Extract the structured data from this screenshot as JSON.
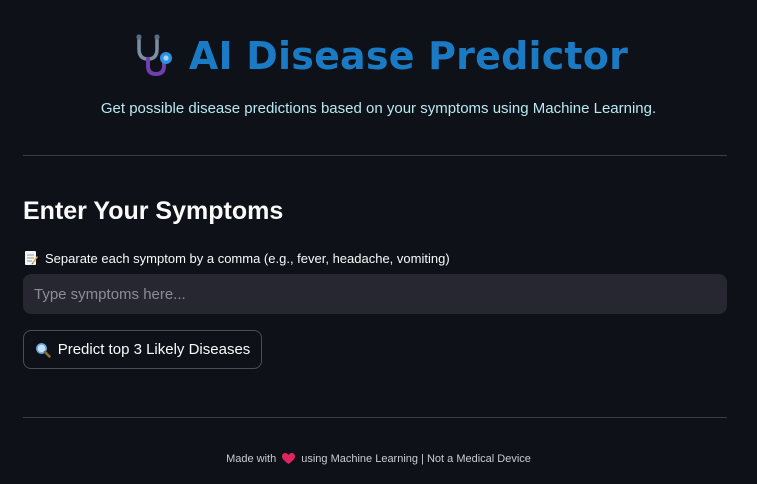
{
  "header": {
    "title": "AI Disease Predictor",
    "title_icon": "stethoscope-icon",
    "subtitle": "Get possible disease predictions based on your symptoms using Machine Learning.",
    "title_color": "#1a7bc4",
    "subtitle_color": "#b8e8f2"
  },
  "form": {
    "heading": "Enter Your Symptoms",
    "label_icon": "memo-icon",
    "label": "Separate each symptom by a comma (e.g., fever, headache, vomiting)",
    "input_value": "",
    "input_placeholder": "Type symptoms here...",
    "button_icon": "magnifier-icon",
    "button_label": "Predict top 3 Likely Diseases"
  },
  "footer": {
    "prefix": "Made with",
    "heart_icon": "heart-icon",
    "suffix": "using Machine Learning | Not a Medical Device"
  },
  "colors": {
    "background": "#0e1117",
    "input_background": "#262730",
    "divider": "#3a3d47",
    "heart": "#e0245e"
  }
}
